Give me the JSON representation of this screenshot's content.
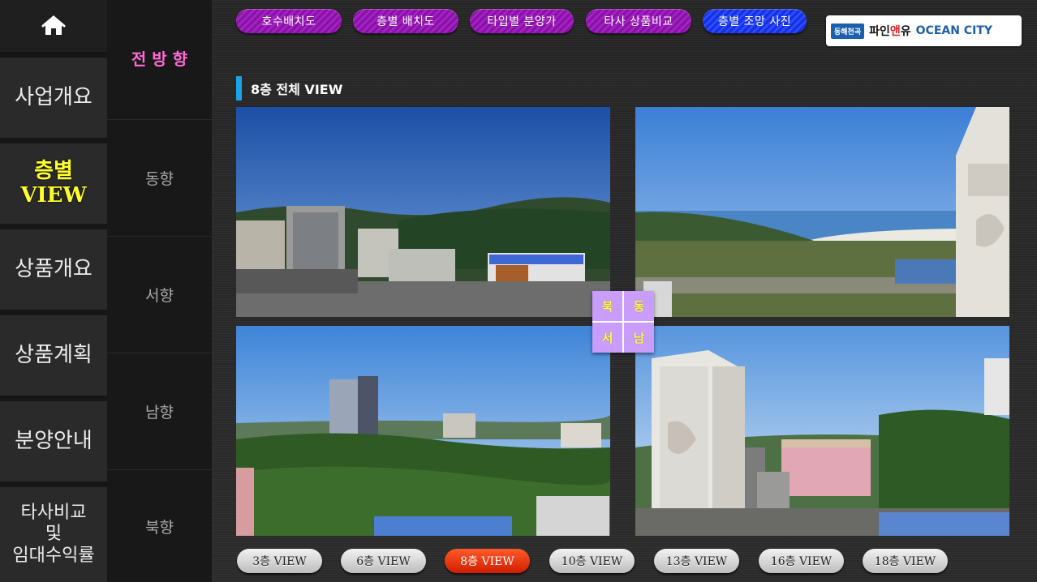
{
  "main_nav": {
    "home_icon": "home-icon",
    "items": [
      {
        "label": "사업개요"
      },
      {
        "label_lines": [
          "층별",
          "VIEW"
        ],
        "active": true
      },
      {
        "label": "상품개요"
      },
      {
        "label": "상품계획"
      },
      {
        "label": "분양안내"
      },
      {
        "label_lines": [
          "타사비교",
          "및",
          "임대수익률"
        ]
      }
    ]
  },
  "direction_nav": {
    "items": [
      {
        "label": "전 방 향",
        "active": true
      },
      {
        "label": "동향"
      },
      {
        "label": "서향"
      },
      {
        "label": "남향"
      },
      {
        "label": "북향"
      }
    ]
  },
  "top_buttons": [
    {
      "label": "호수배치도"
    },
    {
      "label": "층별 배치도"
    },
    {
      "label": "타입별 분양가"
    },
    {
      "label": "타사 상품비교"
    },
    {
      "label": "층별 조망 사진",
      "active": true
    }
  ],
  "logo": {
    "badge": "동해천곡",
    "brand_a": "파인",
    "brand_b": "앤",
    "brand_c": "유",
    "ocean": "OCEAN CITY"
  },
  "section": {
    "title": "8층 전체 VIEW"
  },
  "compass": {
    "north": "북",
    "east": "동",
    "west": "서",
    "south": "남"
  },
  "floor_buttons": [
    {
      "label": "3층 VIEW"
    },
    {
      "label": "6층 VIEW"
    },
    {
      "label": "8층 VIEW",
      "active": true
    },
    {
      "label": "10층 VIEW"
    },
    {
      "label": "13층 VIEW"
    },
    {
      "label": "16층 VIEW"
    },
    {
      "label": "18층 VIEW"
    }
  ],
  "colors": {
    "active_nav": "#ffff2a",
    "active_direction": "#ff6ad5",
    "top_button": "#9a1bbb",
    "top_button_active": "#2340f0",
    "floor_active": "#e03410",
    "title_bar": "#1aa3e8"
  }
}
